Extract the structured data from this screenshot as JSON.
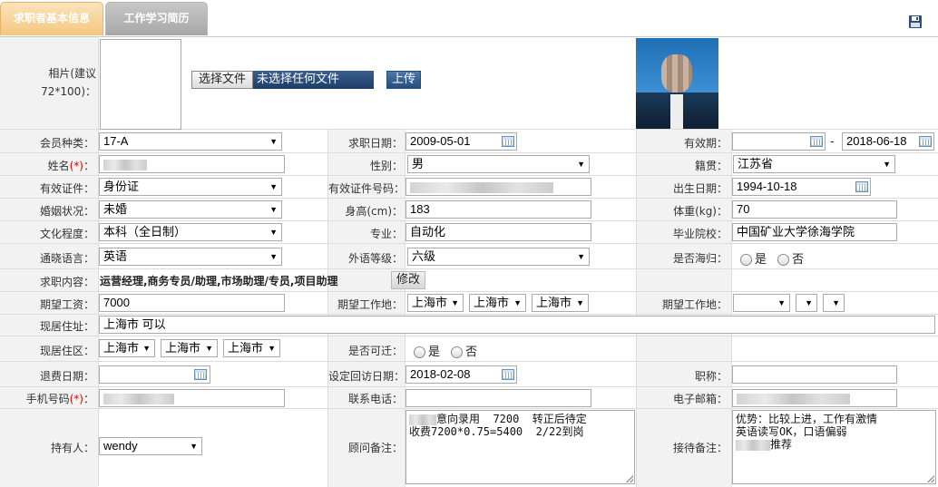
{
  "tabs": {
    "basic": "求职者基本信息",
    "history": "工作学习简历"
  },
  "icons": {
    "save": "save-icon (floppy disk)",
    "calendar": "calendar-icon"
  },
  "photo": {
    "label": "相片(建议72*100)：",
    "choose_button": "选择文件",
    "no_file": "未选择任何文件",
    "upload_button": "上传"
  },
  "member_type": {
    "label": "会员种类：",
    "value": "17-A"
  },
  "job_date": {
    "label": "求职日期：",
    "value": "2009-05-01"
  },
  "valid_period": {
    "label": "有效期：",
    "from": "",
    "sep": "-",
    "to": "2018-06-18"
  },
  "name": {
    "label": "姓名",
    "req": "(*)",
    "colon": "：",
    "value": ""
  },
  "gender": {
    "label": "性别：",
    "value": "男"
  },
  "native": {
    "label": "籍贯：",
    "value": "江苏省"
  },
  "id_type": {
    "label": "有效证件：",
    "value": "身份证"
  },
  "id_number": {
    "label": "有效证件号码：",
    "value": ""
  },
  "birth": {
    "label": "出生日期：",
    "value": "1994-10-18"
  },
  "marital": {
    "label": "婚姻状况：",
    "value": "未婚"
  },
  "height": {
    "label": "身高(cm)：",
    "value": "183"
  },
  "weight": {
    "label": "体重(kg)：",
    "value": "70"
  },
  "education": {
    "label": "文化程度：",
    "value": "本科（全日制）"
  },
  "major": {
    "label": "专业：",
    "value": "自动化"
  },
  "school": {
    "label": "毕业院校：",
    "value": "中国矿业大学徐海学院"
  },
  "language": {
    "label": "通晓语言：",
    "value": "英语"
  },
  "foreign_level": {
    "label": "外语等级：",
    "value": "六级"
  },
  "returnee": {
    "label": "是否海归：",
    "yes": "是",
    "no": "否"
  },
  "job_content": {
    "label": "求职内容：",
    "value": "运营经理,商务专员/助理,市场助理/专员,项目助理",
    "edit_button": "修改"
  },
  "salary": {
    "label": "期望工资：",
    "value": "7000"
  },
  "work_place": {
    "label": "期望工作地：",
    "v1": "上海市",
    "v2": "上海市",
    "v3": "上海市"
  },
  "work_place2": {
    "label": "期望工作地：",
    "v1": "",
    "v2": "",
    "v3": ""
  },
  "address": {
    "label": "现居住址：",
    "value": "上海市 可以"
  },
  "district": {
    "label": "现居住区：",
    "v1": "上海市",
    "v2": "上海市",
    "v3": "上海市"
  },
  "relocate": {
    "label": "是否可迁：",
    "yes": "是",
    "no": "否"
  },
  "refund_date": {
    "label": "退费日期：",
    "value": ""
  },
  "visit_date": {
    "label": "设定回访日期：",
    "value": "2018-02-08"
  },
  "title": {
    "label": "职称：",
    "value": ""
  },
  "mobile": {
    "label": "手机号码",
    "req": "(*)",
    "colon": "："
  },
  "phone": {
    "label": "联系电话：",
    "value": ""
  },
  "email": {
    "label": "电子邮箱："
  },
  "holder": {
    "label": "持有人：",
    "value": "wendy"
  },
  "advisor_note": {
    "label": "顾问备注：",
    "line1": "意向录用  7200  转正后待定",
    "line2": "收费7200*0.75=5400  2/22到岗"
  },
  "reception_note": {
    "label": "接待备注：",
    "line1": "优势：比较上进，工作有激情",
    "line2": "英语读写OK，口语偏弱",
    "line3": "推荐"
  }
}
